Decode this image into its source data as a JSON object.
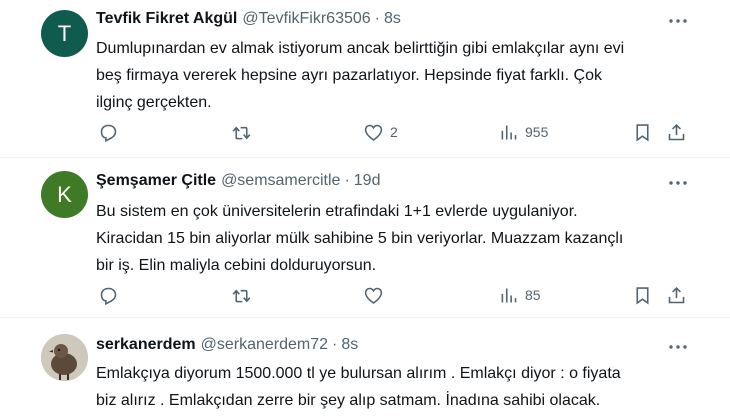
{
  "tweets": [
    {
      "avatar_letter": "T",
      "avatar_color": "#0f5c4e",
      "name": "Tevfik Fikret Akgül",
      "handle": "@TevfikFikr63506",
      "separator": "·",
      "time": "8s",
      "lines": [
        "Dumlupınardan ev almak istiyorum ancak  belirttiğin gibi emlakçılar aynı evi",
        "beş firmaya vererek hepsine ayrı pazarlatıyor. Hepsinde fiyat farklı. Çok",
        "ilginç gerçekten."
      ],
      "likes": "2",
      "views": "955"
    },
    {
      "avatar_letter": "K",
      "avatar_color": "#3f7a26",
      "name": "Şemşamer Çitle",
      "handle": "@semsamercitle",
      "separator": "·",
      "time": "19d",
      "lines": [
        "Bu sistem en çok üniversitelerin etrafindaki 1+1 evlerde uygulaniyor.",
        "Kiracidan 15 bin aliyorlar mülk sahibine 5 bin veriyorlar. Muazzam kazançlı",
        "bir iş. Elin maliyla cebini dolduruyorsun."
      ],
      "likes": "",
      "views": "85"
    },
    {
      "avatar_color": "#c9c3b8",
      "name": "serkanerdem",
      "handle": "@serkanerdem72",
      "separator": "·",
      "time": "8s",
      "lines": [
        "Emlakçıya diyorum 1500.000 tl ye bulursan alırım . Emlakçı diyor : o fiyata",
        "biz alırız . Emlakçıdan zerre bir şey alıp satmam. İnadına sahibi olacak."
      ]
    }
  ],
  "icons": {
    "reply": "reply-icon",
    "retweet": "retweet-icon",
    "like": "heart-icon",
    "views": "views-icon",
    "bookmark": "bookmark-icon",
    "share": "share-icon",
    "more": "more-icon"
  }
}
